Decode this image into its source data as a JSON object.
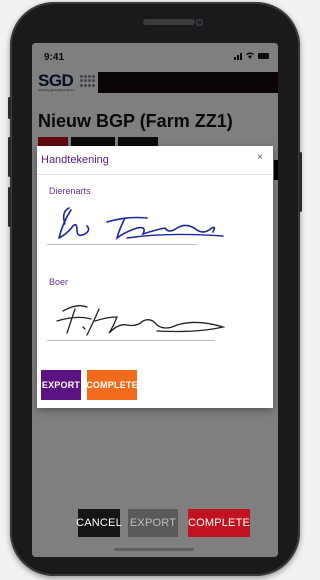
{
  "status_bar": {
    "time": "9:41",
    "icons": "📶 ᯤ ▬"
  },
  "brand": {
    "logo": "SGD",
    "tagline": "stichting gezondheid dieren"
  },
  "page": {
    "title": "Nieuw BGP (Farm ZZ1)"
  },
  "modal": {
    "title": "Handtekening",
    "close": "×",
    "vet_label": "Dierenarts",
    "farmer_label": "Boer",
    "export_label": "EXPORT",
    "complete_label": "COMPLETE"
  },
  "actions": {
    "cancel_label": "CANCEL",
    "export_label": "EXPORT",
    "complete_label": "COMPLETE"
  },
  "colors": {
    "purple": "#5c1283",
    "orange": "#f26b1d",
    "red": "#c0131f",
    "dark": "#151515",
    "grey": "#5a5a5a",
    "tab_red": "#c0131f"
  }
}
